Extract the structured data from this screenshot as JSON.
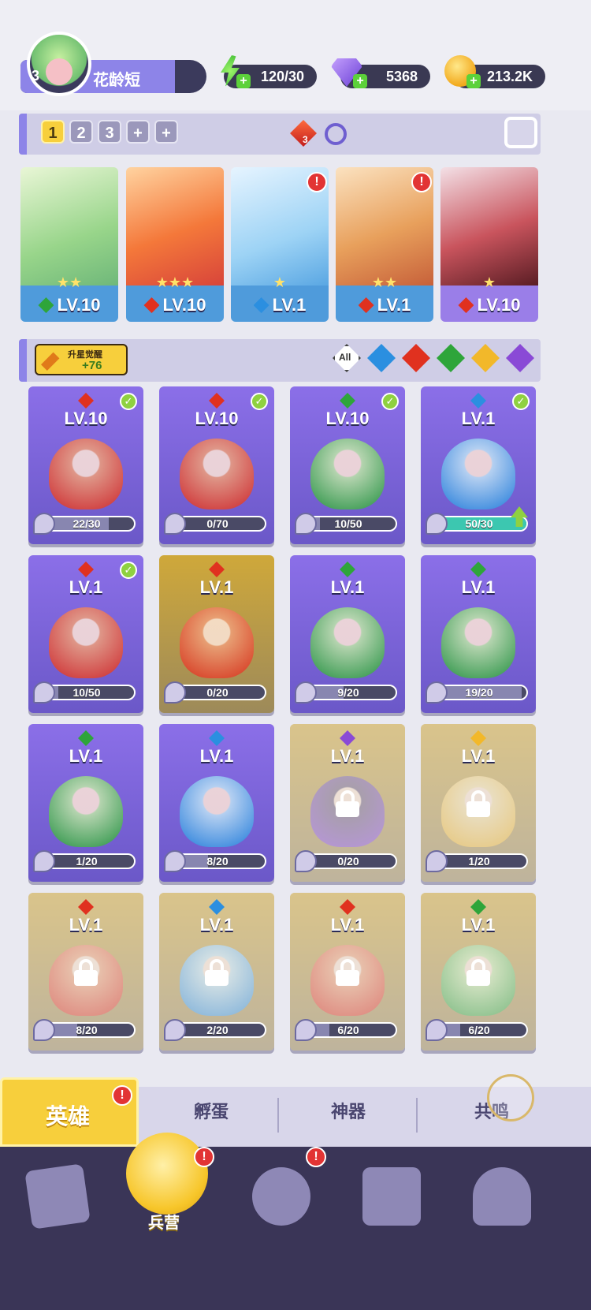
{
  "player": {
    "level": "3",
    "name": "花龄短"
  },
  "resources": {
    "energy": "120/30",
    "gems": "5368",
    "coins": "213.2K"
  },
  "team": {
    "tabs": [
      "1",
      "2",
      "3",
      "+",
      "+"
    ],
    "active_tab": "1",
    "flame_count": "3",
    "members": [
      {
        "element": "nature",
        "level": "LV.10",
        "stars": "★★",
        "alert": false
      },
      {
        "element": "fire",
        "level": "LV.10",
        "stars": "★★★",
        "alert": false
      },
      {
        "element": "water",
        "level": "LV.1",
        "stars": "★",
        "alert": true
      },
      {
        "element": "fire",
        "level": "LV.1",
        "stars": "★★",
        "alert": true
      },
      {
        "element": "fire",
        "level": "LV.10",
        "stars": "★",
        "alert": false
      }
    ]
  },
  "filter": {
    "upgrade_title": "升星觉醒",
    "upgrade_count": "+76",
    "all_label": "All",
    "elements": [
      "water",
      "fire",
      "nature",
      "light",
      "dark"
    ]
  },
  "heroes": [
    {
      "element": "fire",
      "level": "LV.10",
      "progress": "22/30",
      "fraction": 0.73,
      "checked": true,
      "locked": false,
      "style": "purple"
    },
    {
      "element": "fire",
      "level": "LV.10",
      "progress": "0/70",
      "fraction": 0.0,
      "checked": true,
      "locked": false,
      "style": "purple"
    },
    {
      "element": "nature",
      "level": "LV.10",
      "progress": "10/50",
      "fraction": 0.2,
      "checked": true,
      "locked": false,
      "style": "purple"
    },
    {
      "element": "water",
      "level": "LV.1",
      "progress": "50/30",
      "fraction": 1.0,
      "checked": true,
      "locked": false,
      "style": "purple",
      "upgrade": true
    },
    {
      "element": "fire",
      "level": "LV.1",
      "progress": "10/50",
      "fraction": 0.2,
      "checked": true,
      "locked": false,
      "style": "purple"
    },
    {
      "element": "fire",
      "level": "LV.1",
      "progress": "0/20",
      "fraction": 0.0,
      "checked": false,
      "locked": false,
      "style": "gold"
    },
    {
      "element": "nature",
      "level": "LV.1",
      "progress": "9/20",
      "fraction": 0.45,
      "checked": false,
      "locked": false,
      "style": "purple"
    },
    {
      "element": "nature",
      "level": "LV.1",
      "progress": "19/20",
      "fraction": 0.95,
      "checked": false,
      "locked": false,
      "style": "purple"
    },
    {
      "element": "nature",
      "level": "LV.1",
      "progress": "1/20",
      "fraction": 0.05,
      "checked": false,
      "locked": false,
      "style": "purple"
    },
    {
      "element": "water",
      "level": "LV.1",
      "progress": "8/20",
      "fraction": 0.4,
      "checked": false,
      "locked": false,
      "style": "purple"
    },
    {
      "element": "dark",
      "level": "LV.1",
      "progress": "0/20",
      "fraction": 0.0,
      "checked": false,
      "locked": true,
      "style": "gold"
    },
    {
      "element": "light",
      "level": "LV.1",
      "progress": "1/20",
      "fraction": 0.05,
      "checked": false,
      "locked": true,
      "style": "gold"
    },
    {
      "element": "fire",
      "level": "LV.1",
      "progress": "8/20",
      "fraction": 0.4,
      "checked": false,
      "locked": true,
      "style": "gold"
    },
    {
      "element": "water",
      "level": "LV.1",
      "progress": "2/20",
      "fraction": 0.1,
      "checked": false,
      "locked": true,
      "style": "gold"
    },
    {
      "element": "fire",
      "level": "LV.1",
      "progress": "6/20",
      "fraction": 0.3,
      "checked": false,
      "locked": true,
      "style": "gold"
    },
    {
      "element": "nature",
      "level": "LV.1",
      "progress": "6/20",
      "fraction": 0.3,
      "checked": false,
      "locked": true,
      "style": "gold"
    }
  ],
  "subtabs": {
    "active": "英雄",
    "items": [
      "孵蛋",
      "神器",
      "共鸣"
    ]
  },
  "navbar": {
    "active_label": "兵营",
    "icons": [
      "cards-icon",
      "barracks-icon",
      "map-icon",
      "locked-shop-icon",
      "mushroom-icon"
    ]
  },
  "colors": {
    "accent_purple": "#8d84e8",
    "gold": "#f7cf3c",
    "nav_bg": "#3a3557"
  }
}
